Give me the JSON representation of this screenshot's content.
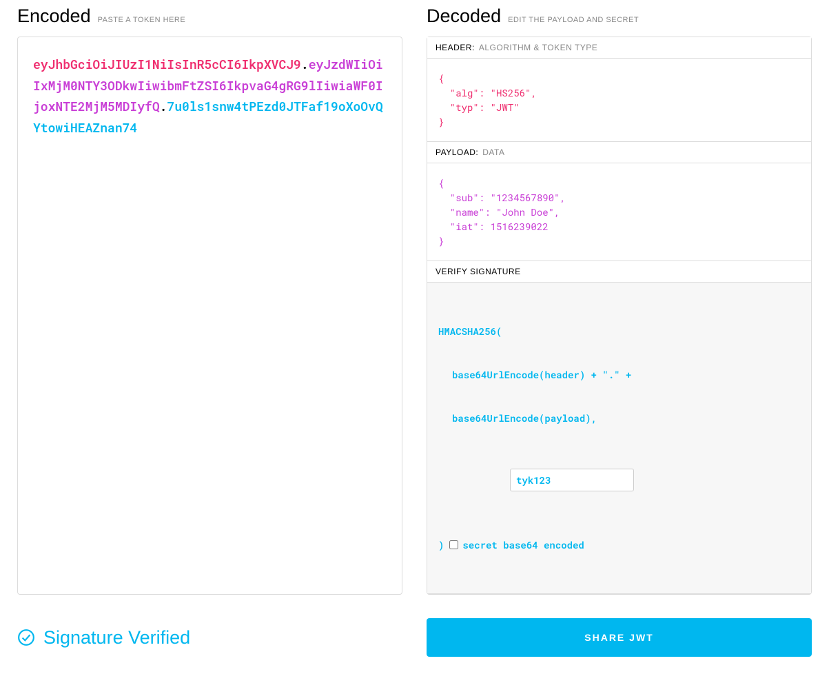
{
  "encoded": {
    "title": "Encoded",
    "subtitle": "PASTE A TOKEN HERE",
    "token_header": "eyJhbGciOiJIUzI1NiIsInR5cCI6IkpXVCJ9",
    "token_payload": "eyJzdWIiOiIxMjM0NTY3ODkwIiwibmFtZSI6IkpvaG4gRG9lIiwiaWF0IjoxNTE2MjM5MDIyfQ",
    "token_signature": "7u0ls1snw4tPEzd0JTFaf19oXoOvQYtowiHEAZnan74"
  },
  "decoded": {
    "title": "Decoded",
    "subtitle": "EDIT THE PAYLOAD AND SECRET",
    "header_section": {
      "label": "HEADER:",
      "sublabel": "ALGORITHM & TOKEN TYPE",
      "body": "{\n  \"alg\": \"HS256\",\n  \"typ\": \"JWT\"\n}"
    },
    "payload_section": {
      "label": "PAYLOAD:",
      "sublabel": "DATA",
      "body": "{\n  \"sub\": \"1234567890\",\n  \"name\": \"John Doe\",\n  \"iat\": 1516239022\n}"
    },
    "signature_section": {
      "label": "VERIFY SIGNATURE",
      "line1": "HMACSHA256(",
      "line2": "base64UrlEncode(header) + \".\" +",
      "line3": "base64UrlEncode(payload),",
      "secret_value": "tyk123",
      "line4_prefix": ")",
      "checkbox_label": "secret base64 encoded"
    }
  },
  "footer": {
    "verified_text": "Signature Verified",
    "share_label": "SHARE JWT"
  },
  "colors": {
    "header": "#ef2e6f",
    "payload": "#c93fd6",
    "signature": "#00b7ef"
  }
}
